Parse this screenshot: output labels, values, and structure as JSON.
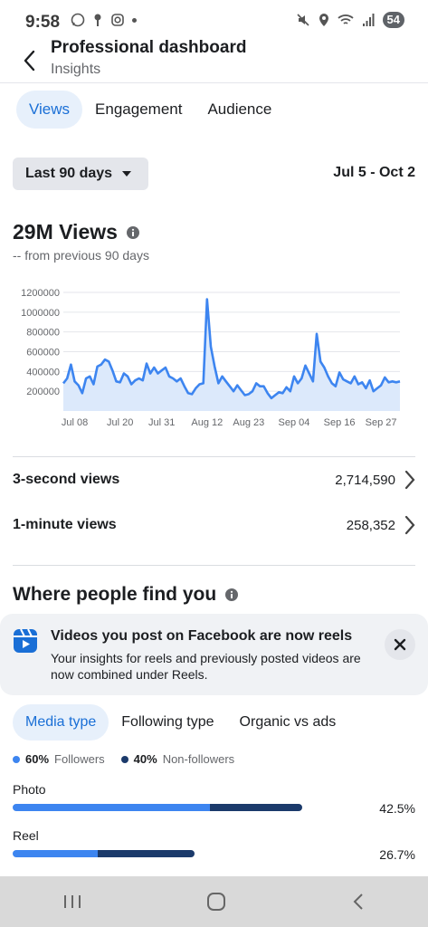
{
  "status_bar": {
    "time": "9:58",
    "battery": "54"
  },
  "header": {
    "title": "Professional dashboard",
    "subtitle": "Insights"
  },
  "tabs": [
    {
      "label": "Views",
      "active": true
    },
    {
      "label": "Engagement",
      "active": false
    },
    {
      "label": "Audience",
      "active": false
    }
  ],
  "filter": {
    "range_label": "Last 90 days",
    "date_range": "Jul 5 - Oct 2"
  },
  "metric": {
    "title": "29M Views",
    "subtitle": "-- from previous 90 days"
  },
  "chart_data": {
    "type": "line",
    "title": "",
    "xlabel": "",
    "ylabel": "",
    "ylim": [
      0,
      1200000
    ],
    "y_ticks": [
      "1200000",
      "1000000",
      "800000",
      "600000",
      "400000",
      "200000"
    ],
    "x_ticks": [
      "Jul 08",
      "Jul 20",
      "Jul 31",
      "Aug 12",
      "Aug 23",
      "Sep 04",
      "Sep 16",
      "Sep 27"
    ],
    "series": [
      {
        "color": "#3d85f0",
        "x": [
          "Jul 05",
          "Jul 06",
          "Jul 07",
          "Jul 08",
          "Jul 09",
          "Jul 10",
          "Jul 11",
          "Jul 12",
          "Jul 13",
          "Jul 14",
          "Jul 15",
          "Jul 16",
          "Jul 17",
          "Jul 18",
          "Jul 19",
          "Jul 20",
          "Jul 21",
          "Jul 22",
          "Jul 23",
          "Jul 24",
          "Jul 25",
          "Jul 26",
          "Jul 27",
          "Jul 28",
          "Jul 29",
          "Jul 30",
          "Jul 31",
          "Aug 01",
          "Aug 02",
          "Aug 03",
          "Aug 04",
          "Aug 05",
          "Aug 06",
          "Aug 07",
          "Aug 08",
          "Aug 09",
          "Aug 10",
          "Aug 11",
          "Aug 12",
          "Aug 13",
          "Aug 14",
          "Aug 15",
          "Aug 16",
          "Aug 17",
          "Aug 18",
          "Aug 19",
          "Aug 20",
          "Aug 21",
          "Aug 22",
          "Aug 23",
          "Aug 24",
          "Aug 25",
          "Aug 26",
          "Aug 27",
          "Aug 28",
          "Aug 29",
          "Aug 30",
          "Aug 31",
          "Sep 01",
          "Sep 02",
          "Sep 03",
          "Sep 04",
          "Sep 05",
          "Sep 06",
          "Sep 07",
          "Sep 08",
          "Sep 09",
          "Sep 10",
          "Sep 11",
          "Sep 12",
          "Sep 13",
          "Sep 14",
          "Sep 15",
          "Sep 16",
          "Sep 17",
          "Sep 18",
          "Sep 19",
          "Sep 20",
          "Sep 21",
          "Sep 22",
          "Sep 23",
          "Sep 24",
          "Sep 25",
          "Sep 26",
          "Sep 27",
          "Sep 28",
          "Sep 29",
          "Sep 30",
          "Oct 01",
          "Oct 02"
        ],
        "values": [
          280000,
          330000,
          470000,
          300000,
          260000,
          180000,
          330000,
          350000,
          270000,
          450000,
          470000,
          520000,
          500000,
          410000,
          300000,
          290000,
          380000,
          350000,
          270000,
          310000,
          330000,
          310000,
          480000,
          380000,
          440000,
          380000,
          410000,
          440000,
          350000,
          330000,
          300000,
          330000,
          250000,
          180000,
          170000,
          230000,
          270000,
          280000,
          1130000,
          650000,
          450000,
          280000,
          350000,
          300000,
          250000,
          200000,
          260000,
          210000,
          160000,
          170000,
          200000,
          280000,
          250000,
          250000,
          180000,
          130000,
          160000,
          190000,
          180000,
          240000,
          200000,
          350000,
          280000,
          330000,
          460000,
          380000,
          300000,
          780000,
          500000,
          440000,
          350000,
          280000,
          250000,
          390000,
          320000,
          300000,
          280000,
          350000,
          270000,
          290000,
          230000,
          310000,
          200000,
          230000,
          260000,
          340000,
          290000,
          300000,
          290000,
          300000
        ]
      }
    ]
  },
  "rows": [
    {
      "label": "3-second views",
      "value": "2,714,590"
    },
    {
      "label": "1-minute views",
      "value": "258,352"
    }
  ],
  "section_title": "Where people find you",
  "banner": {
    "title": "Videos you post on Facebook are now reels",
    "body": "Your insights for reels and previously posted videos are now combined under Reels."
  },
  "subtabs": [
    {
      "label": "Media type",
      "active": true
    },
    {
      "label": "Following type",
      "active": false
    },
    {
      "label": "Organic vs ads",
      "active": false
    }
  ],
  "legend": {
    "followers_pct": "60%",
    "followers_label": "Followers",
    "followers_color": "#3d85f0",
    "nonfollowers_pct": "40%",
    "nonfollowers_label": "Non-followers",
    "nonfollowers_color": "#1b3a6b"
  },
  "media_bars": [
    {
      "label": "Photo",
      "percent": "42.5%",
      "share": 0.425,
      "followers_share": 0.68
    },
    {
      "label": "Reel",
      "percent": "26.7%",
      "share": 0.267,
      "followers_share": 0.47
    }
  ]
}
